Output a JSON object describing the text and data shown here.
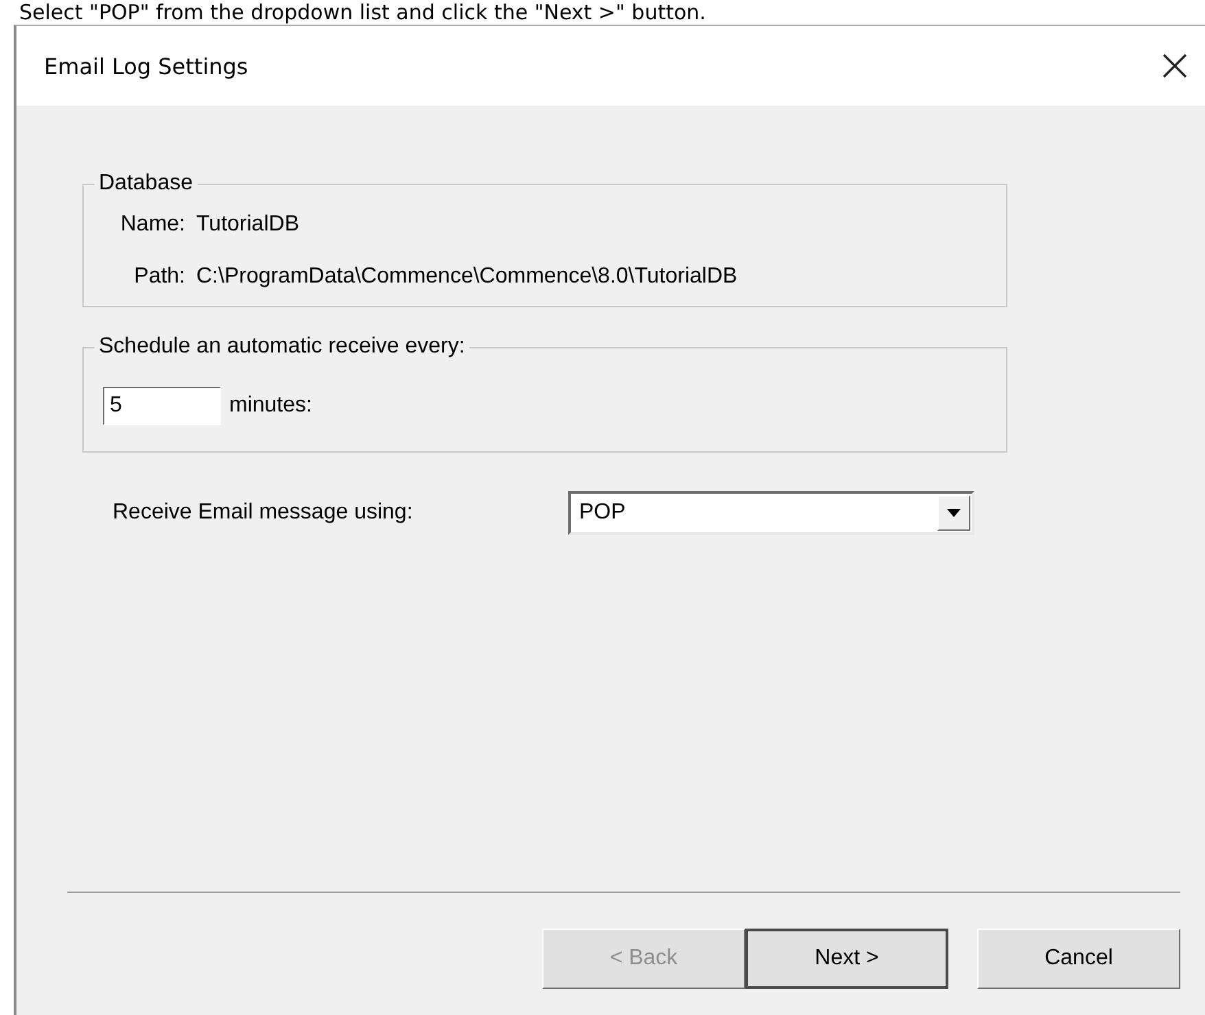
{
  "instruction": "Select \"POP\" from the dropdown list and click the \"Next >\" button.",
  "window": {
    "title": "Email Log Settings"
  },
  "database_group": {
    "title": "Database",
    "fields": [
      {
        "label": "Name:",
        "value": "TutorialDB"
      },
      {
        "label": "Path:",
        "value": "C:\\ProgramData\\Commence\\Commence\\8.0\\TutorialDB"
      }
    ]
  },
  "schedule_group": {
    "title": "Schedule an automatic receive every:",
    "interval": {
      "value": "5"
    },
    "unit": "minutes:"
  },
  "receive": {
    "label": "Receive Email message using:",
    "value": "POP"
  },
  "buttons": [
    {
      "label": "< Back",
      "disabled": true,
      "default": false
    },
    {
      "label": "Next >",
      "disabled": false,
      "default": true
    },
    {
      "label": "Cancel",
      "disabled": false,
      "default": false
    }
  ]
}
